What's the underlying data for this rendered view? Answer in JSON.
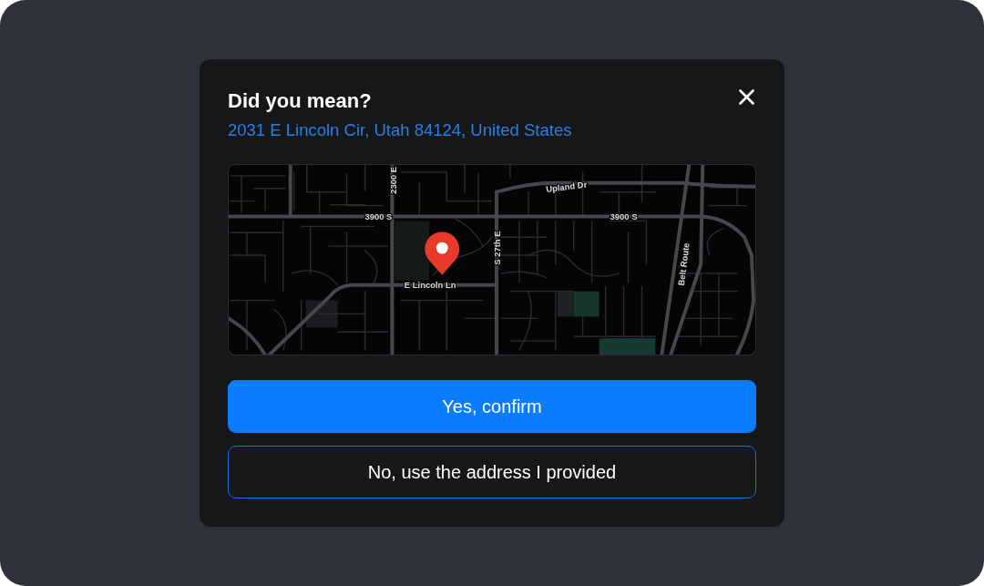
{
  "dialog": {
    "title": "Did you mean?",
    "address": "2031 E Lincoln Cir, Utah 84124, United States"
  },
  "map": {
    "labels": [
      "2300 E",
      "Upland Dr",
      "3900 S",
      "3900 S",
      "S 27th E",
      "Belt Route",
      "E Lincoln Ln"
    ]
  },
  "buttons": [
    {
      "label": "Yes, confirm",
      "kind": "primary"
    },
    {
      "label": "No, use the address I provided",
      "kind": "secondary"
    }
  ]
}
